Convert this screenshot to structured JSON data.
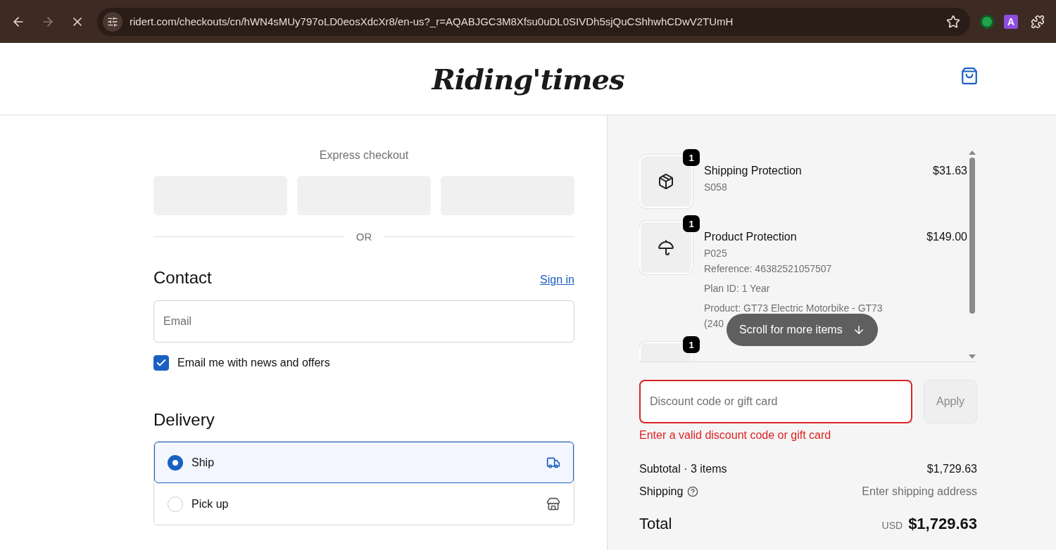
{
  "browser": {
    "url": "ridert.com/checkouts/cn/hWN4sMUy797oLD0eosXdcXr8/en-us?_r=AQABJGC3M8Xfsu0uDL0SIVDh5sjQuCShhwhCDwV2TUmH",
    "forward_disabled": true,
    "extension_letter": "A"
  },
  "header": {
    "logo": "Riding'times"
  },
  "express": {
    "label": "Express checkout",
    "divider": "OR"
  },
  "contact": {
    "title": "Contact",
    "sign_in": "Sign in",
    "email_placeholder": "Email",
    "newsletter": {
      "label": "Email me with news and offers",
      "checked": true
    }
  },
  "delivery": {
    "title": "Delivery",
    "options": [
      {
        "label": "Ship",
        "selected": true,
        "kind": "ship"
      },
      {
        "label": "Pick up",
        "selected": false,
        "kind": "pickup"
      }
    ]
  },
  "summary": {
    "items": [
      {
        "quantity": "1",
        "name": "Shipping Protection",
        "price": "$31.63",
        "kind": "shipping",
        "details": [
          "S058"
        ]
      },
      {
        "quantity": "1",
        "name": "Product Protection",
        "price": "$149.00",
        "kind": "product",
        "details": [
          "P025",
          "Reference: 46382521057507",
          "Plan ID: 1 Year",
          "Product: GT73 Electric Motorbike - GT73",
          "(240"
        ]
      },
      {
        "quantity": "1",
        "kind": "bike"
      }
    ],
    "scroll_hint": "Scroll for more items",
    "discount": {
      "placeholder": "Discount code or gift card",
      "error": "Enter a valid discount code or gift card",
      "button": "Apply"
    },
    "subtotal_label": "Subtotal · 3 items",
    "subtotal": "$1,729.63",
    "shipping_label": "Shipping",
    "shipping_value": "Enter shipping address",
    "total_label": "Total",
    "currency": "USD",
    "total": "$1,729.63"
  }
}
